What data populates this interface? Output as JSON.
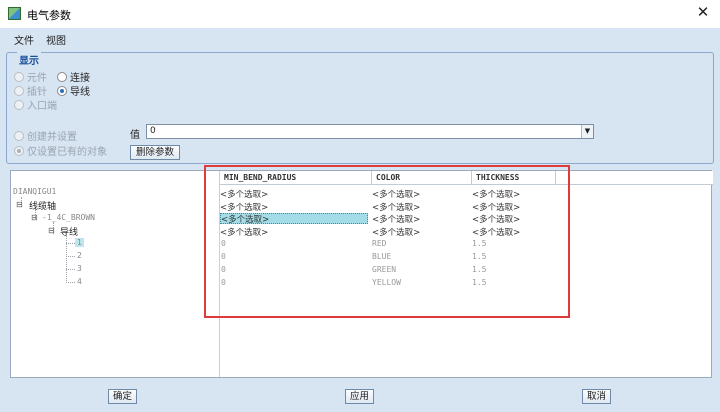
{
  "window": {
    "title": "电气参数",
    "close": "✕"
  },
  "menu": [
    "文件",
    "视图"
  ],
  "display": {
    "legend": "显示",
    "options": {
      "component": "元件",
      "connection": "连接",
      "pin": "插针",
      "wire": "导线",
      "entry": "入口端"
    }
  },
  "mode": {
    "create_and_set": "创建并设置",
    "only_existing": "仅设置已有的对象"
  },
  "value": {
    "label": "值",
    "current": "0"
  },
  "delete_button": "删除参数",
  "grid": {
    "columns": [
      "MIN_BEND_RADIUS",
      "COLOR",
      "THICKNESS"
    ],
    "multi_label": "<多个选取>",
    "tree": {
      "root": "DIANQIGU1",
      "harness": "线缆轴",
      "cable": "-1_4C_BROWN",
      "wire_group": "导线",
      "wires": [
        "1",
        "2",
        "3",
        "4"
      ]
    },
    "rows": [
      {
        "MIN_BEND_RADIUS": "0",
        "COLOR": "RED",
        "THICKNESS": "1.5"
      },
      {
        "MIN_BEND_RADIUS": "0",
        "COLOR": "BLUE",
        "THICKNESS": "1.5"
      },
      {
        "MIN_BEND_RADIUS": "0",
        "COLOR": "GREEN",
        "THICKNESS": "1.5"
      },
      {
        "MIN_BEND_RADIUS": "0",
        "COLOR": "YELLOW",
        "THICKNESS": "1.5"
      }
    ]
  },
  "buttons": {
    "ok": "确定",
    "apply": "应用",
    "cancel": "取消"
  },
  "colors": {
    "highlight_box": "#e03b3b",
    "selection": "#a3dce6"
  }
}
